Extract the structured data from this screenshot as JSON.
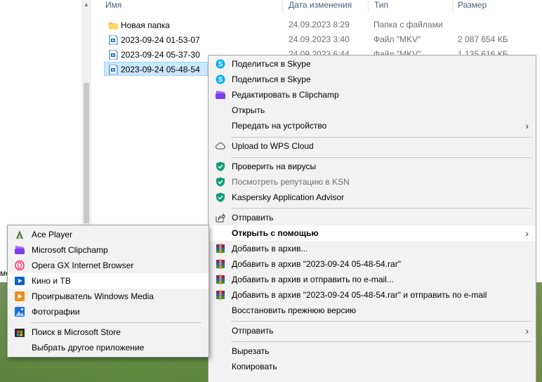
{
  "explorer": {
    "nav_fragment": "ме",
    "columns": {
      "name": "Имя",
      "date": "Дата изменения",
      "type": "Тип",
      "size": "Размер"
    },
    "files": [
      {
        "name": "Новая папка",
        "date": "24.09.2023 8:29",
        "type": "Папка с файлами",
        "size": "",
        "icon": "folder-icon"
      },
      {
        "name": "2023-09-24 01-53-07",
        "date": "24.09.2023 3:40",
        "type": "Файл \"MKV\"",
        "size": "2 087 654 КБ",
        "icon": "video-file-icon"
      },
      {
        "name": "2023-09-24 05-37-30",
        "date": "24.09.2023 6:44",
        "type": "Файл \"MKV\"",
        "size": "1 135 616 КБ",
        "icon": "video-file-icon"
      },
      {
        "name": "2023-09-24 05-48-54",
        "date": "",
        "type": "",
        "size": "",
        "icon": "video-file-icon",
        "selected": true
      }
    ]
  },
  "context_menu": {
    "share_skype_1": "Поделиться в Skype",
    "share_skype_2": "Поделиться в Skype",
    "edit_clipchamp": "Редактировать в Clipchamp",
    "open": "Открыть",
    "cast_to_device": "Передать на устройство",
    "upload_wps": "Upload to WPS Cloud",
    "scan_viruses": "Проверить на вирусы",
    "ksn_reputation": "Посмотреть репутацию в KSN",
    "kaspersky_advisor": "Kaspersky Application Advisor",
    "share": "Отправить",
    "open_with": "Открыть с помощью",
    "add_archive": "Добавить в архив...",
    "add_archive_named": "Добавить в архив \"2023-09-24 05-48-54.rar\"",
    "add_archive_email": "Добавить в архив и отправить по e-mail...",
    "add_archive_named_email": "Добавить в архив \"2023-09-24 05-48-54.rar\" и отправить по e-mail",
    "restore_version": "Восстановить прежнюю версию",
    "send_to": "Отправить",
    "cut": "Вырезать",
    "copy": "Копировать"
  },
  "open_with_menu": {
    "ace_player": "Ace Player",
    "clipchamp": "Microsoft Clipchamp",
    "opera_gx": "Opera GX Internet Browser",
    "movies_tv": "Кино и ТВ",
    "wmp": "Проигрыватель Windows Media",
    "photos": "Фотографии",
    "store_search": "Поиск в Microsoft Store",
    "choose_other": "Выбрать другое приложение"
  },
  "colors": {
    "selection": "#cce8ff",
    "menu_bg": "#f2f2f2",
    "menu_highlight": "#ffffff",
    "kaspersky_green": "#0f9d78",
    "skype_blue": "#00aff0"
  }
}
